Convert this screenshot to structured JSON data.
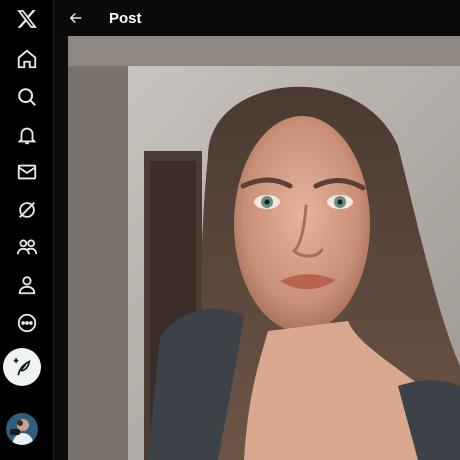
{
  "app": {
    "name": "X"
  },
  "header": {
    "title": "Post",
    "back_icon": "arrow-left-icon"
  },
  "sidebar": {
    "items": [
      {
        "name": "logo",
        "icon": "x-logo-icon"
      },
      {
        "name": "home",
        "icon": "home-icon"
      },
      {
        "name": "explore",
        "icon": "search-icon"
      },
      {
        "name": "notifications",
        "icon": "bell-icon"
      },
      {
        "name": "messages",
        "icon": "envelope-icon"
      },
      {
        "name": "grok",
        "icon": "grok-icon"
      },
      {
        "name": "communities",
        "icon": "people-icon"
      },
      {
        "name": "profile",
        "icon": "person-icon"
      },
      {
        "name": "more",
        "icon": "more-circle-icon"
      }
    ],
    "compose_icon": "feather-plus-icon"
  },
  "colors": {
    "background": "#000000",
    "text": "#e7e9ea",
    "compose_bg": "#eff3f4"
  }
}
